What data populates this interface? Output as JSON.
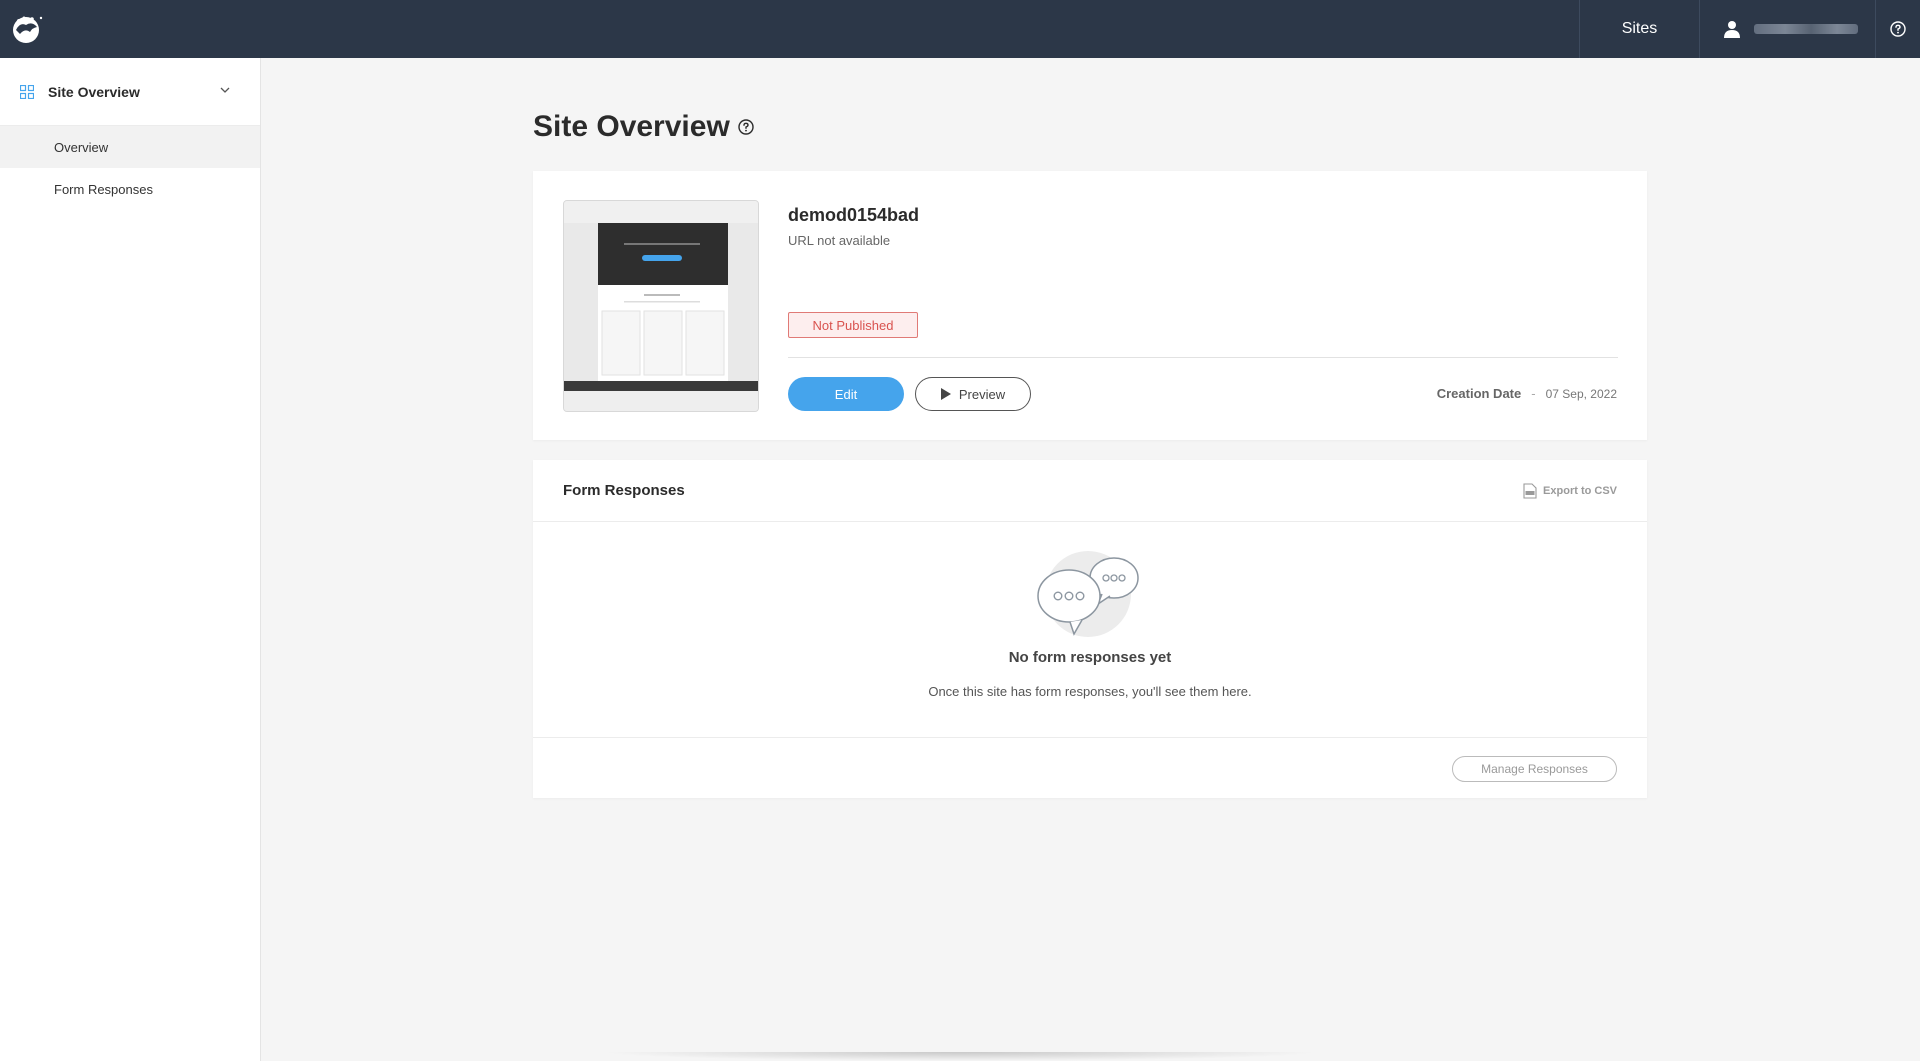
{
  "topbar": {
    "logo_icon": "brand-logo-icon",
    "sites_label": "Sites",
    "user_icon": "user-icon",
    "help_icon": "help-icon"
  },
  "sidebar": {
    "header_label": "Site Overview",
    "header_icon": "grid-icon",
    "items": [
      {
        "label": "Overview",
        "active": true
      },
      {
        "label": "Form Responses",
        "active": false
      }
    ]
  },
  "page": {
    "title": "Site Overview"
  },
  "site": {
    "name": "demod0154bad",
    "url_text": "URL not available",
    "status": "Not Published",
    "edit_label": "Edit",
    "preview_label": "Preview",
    "creation_label": "Creation Date",
    "creation_separator": "-",
    "creation_date": "07 Sep, 2022"
  },
  "forms": {
    "title": "Form Responses",
    "export_label": "Export to CSV",
    "empty_title": "No form responses yet",
    "empty_subtitle": "Once this site has form responses, you'll see them here.",
    "manage_label": "Manage Responses"
  },
  "colors": {
    "topbar": "#2c3748",
    "accent": "#45a4ec",
    "status_red": "#d9534f"
  }
}
